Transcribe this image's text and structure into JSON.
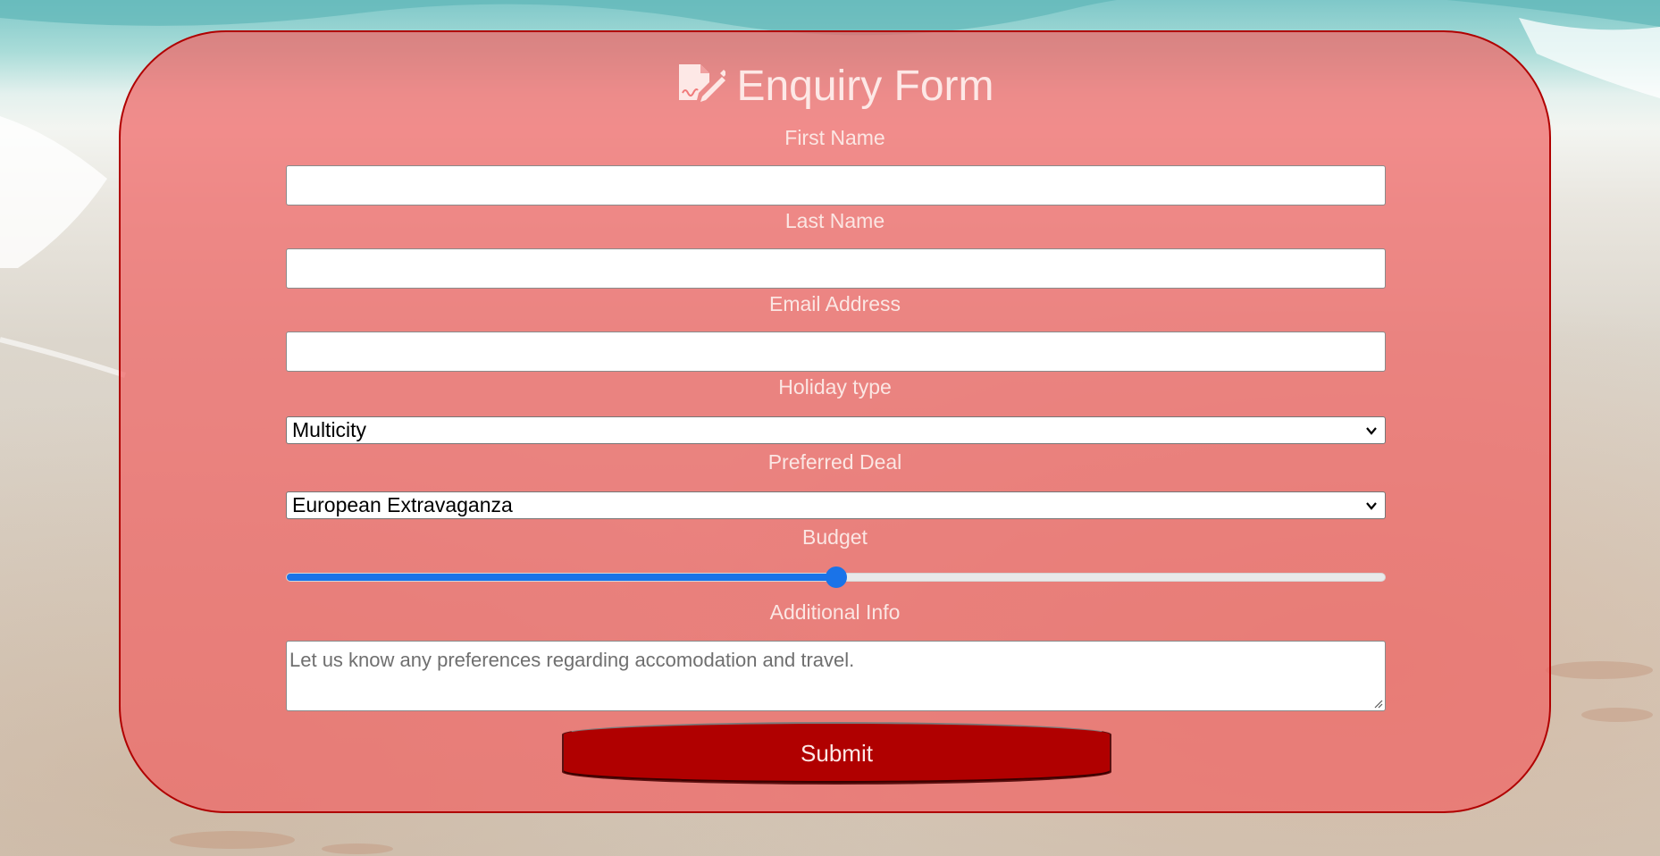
{
  "form": {
    "title": "Enquiry Form",
    "title_icon": "file-signature-icon",
    "fields": {
      "first_name": {
        "label": "First Name",
        "value": ""
      },
      "last_name": {
        "label": "Last Name",
        "value": ""
      },
      "email": {
        "label": "Email Address",
        "value": ""
      },
      "holiday_type": {
        "label": "Holiday type",
        "selected": "Multicity"
      },
      "preferred_deal": {
        "label": "Preferred Deal",
        "selected": "European Extravaganza"
      },
      "budget": {
        "label": "Budget",
        "level_percent": 50
      },
      "additional_info": {
        "label": "Additional Info",
        "placeholder": "Let us know any preferences regarding accomodation and travel."
      }
    },
    "submit_label": "Submit"
  },
  "colors": {
    "card_fill": "#f06464",
    "card_border": "#b00000",
    "submit_bg": "#b00000",
    "slider_accent": "#1a73e8"
  }
}
